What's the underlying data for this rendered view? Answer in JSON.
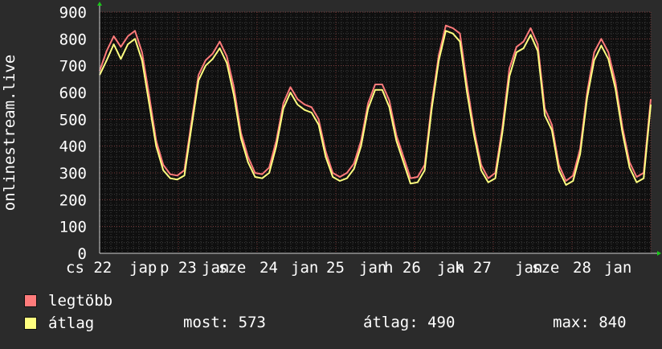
{
  "chart_data": {
    "type": "line",
    "ylabel": "onlinestream.live",
    "ylim": [
      0,
      900
    ],
    "yticks": [
      0,
      100,
      200,
      300,
      400,
      500,
      600,
      700,
      800,
      900
    ],
    "grid": true,
    "xtick_labels": [
      "cs 22",
      "jap",
      "p 23",
      "jan",
      "sze",
      "24",
      "jan",
      "25",
      "jan",
      "h 26",
      "jan",
      "k 27",
      "jan",
      "sze",
      "28",
      "jan"
    ],
    "series": [
      {
        "name": "legtöbb",
        "color": "#ff7b7b",
        "values": [
          680,
          755,
          810,
          770,
          810,
          830,
          750,
          590,
          420,
          330,
          295,
          290,
          310,
          490,
          665,
          720,
          745,
          790,
          735,
          620,
          450,
          360,
          300,
          295,
          320,
          420,
          560,
          620,
          575,
          555,
          545,
          500,
          380,
          300,
          285,
          300,
          335,
          420,
          560,
          630,
          630,
          570,
          440,
          360,
          280,
          285,
          330,
          560,
          740,
          850,
          840,
          820,
          630,
          460,
          330,
          280,
          300,
          470,
          690,
          770,
          790,
          840,
          780,
          540,
          480,
          330,
          270,
          290,
          390,
          600,
          750,
          800,
          750,
          640,
          470,
          340,
          285,
          300,
          575
        ]
      },
      {
        "name": "átlag",
        "color": "#ffff80",
        "values": [
          665,
          720,
          780,
          725,
          780,
          800,
          720,
          560,
          400,
          310,
          280,
          275,
          290,
          470,
          645,
          700,
          725,
          765,
          710,
          590,
          430,
          340,
          285,
          280,
          300,
          400,
          540,
          600,
          555,
          535,
          525,
          480,
          360,
          285,
          270,
          280,
          315,
          400,
          540,
          610,
          610,
          545,
          420,
          340,
          260,
          265,
          310,
          540,
          720,
          830,
          820,
          790,
          600,
          440,
          310,
          265,
          280,
          450,
          660,
          750,
          765,
          815,
          755,
          515,
          460,
          310,
          255,
          270,
          370,
          580,
          720,
          775,
          725,
          615,
          450,
          320,
          265,
          280,
          555
        ]
      }
    ]
  },
  "stats": {
    "current": "most: 573",
    "average": "átlag: 490",
    "max": "max: 840"
  },
  "colors": {
    "background": "#2b2b2b",
    "plot_background": "#0f0f0f",
    "grid_major": "#7a3a3a",
    "grid_minor": "#3c3c3c",
    "text": "#ffffff",
    "arrow": "#19c819"
  }
}
